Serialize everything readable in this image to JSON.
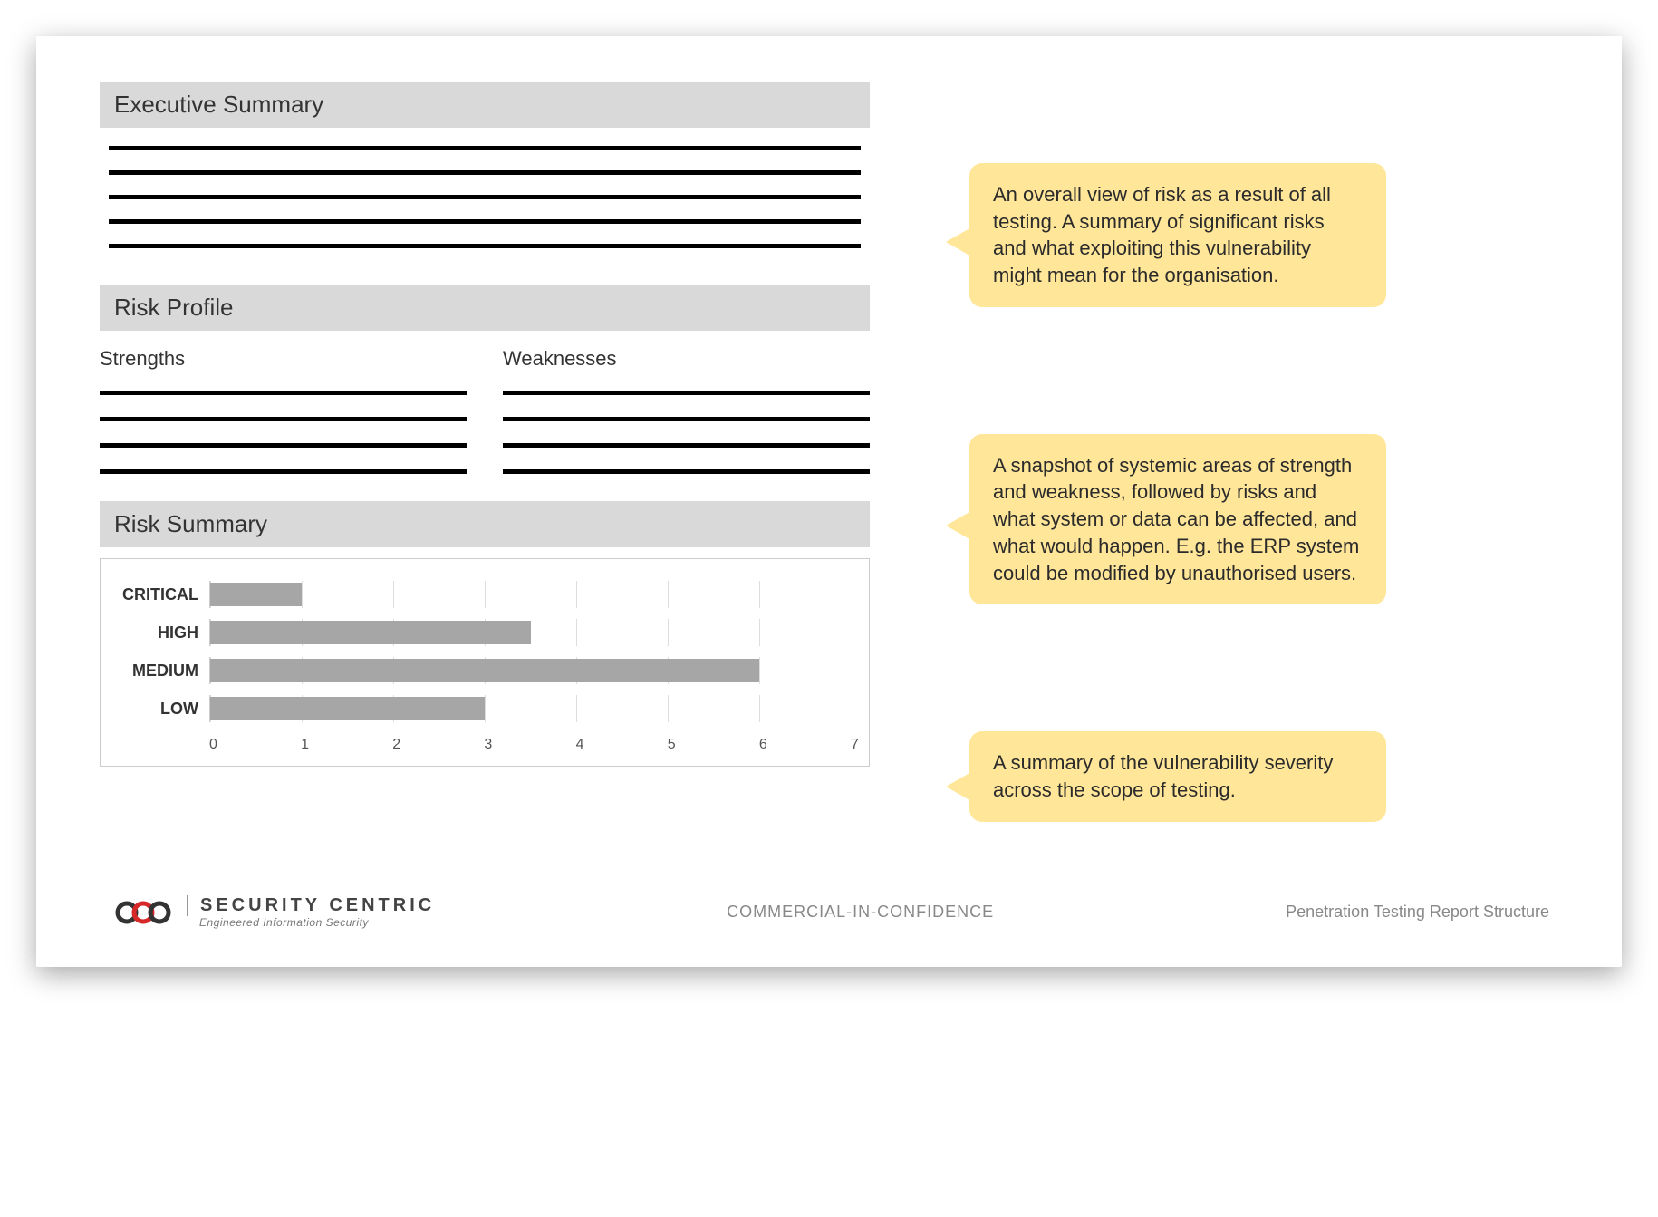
{
  "sections": {
    "exec_summary": {
      "title": "Executive Summary"
    },
    "risk_profile": {
      "title": "Risk Profile",
      "strengths_label": "Strengths",
      "weaknesses_label": "Weaknesses"
    },
    "risk_summary": {
      "title": "Risk Summary"
    }
  },
  "callouts": {
    "c1": "An overall view of risk as a result of all testing. A summary of significant risks and what exploiting this vulnerability might mean for the organisation.",
    "c2": "A snapshot of systemic areas of strength and weakness, followed by risks and what system or data can be affected, and what would happen. E.g. the ERP system could be modified by unauthorised users.",
    "c3": "A summary of the vulnerability severity across the scope of testing."
  },
  "chart_data": {
    "type": "bar",
    "orientation": "horizontal",
    "categories": [
      "CRITICAL",
      "HIGH",
      "MEDIUM",
      "LOW"
    ],
    "values": [
      1,
      3.5,
      6,
      3
    ],
    "xlim": [
      0,
      7
    ],
    "xticks": [
      0,
      1,
      2,
      3,
      4,
      5,
      6,
      7
    ],
    "title": "",
    "xlabel": "",
    "ylabel": ""
  },
  "footer": {
    "brand_main": "SECURITY CENTRIC",
    "brand_sub": "Engineered Information Security",
    "center": "COMMERCIAL-IN-CONFIDENCE",
    "right": "Penetration Testing Report Structure"
  }
}
